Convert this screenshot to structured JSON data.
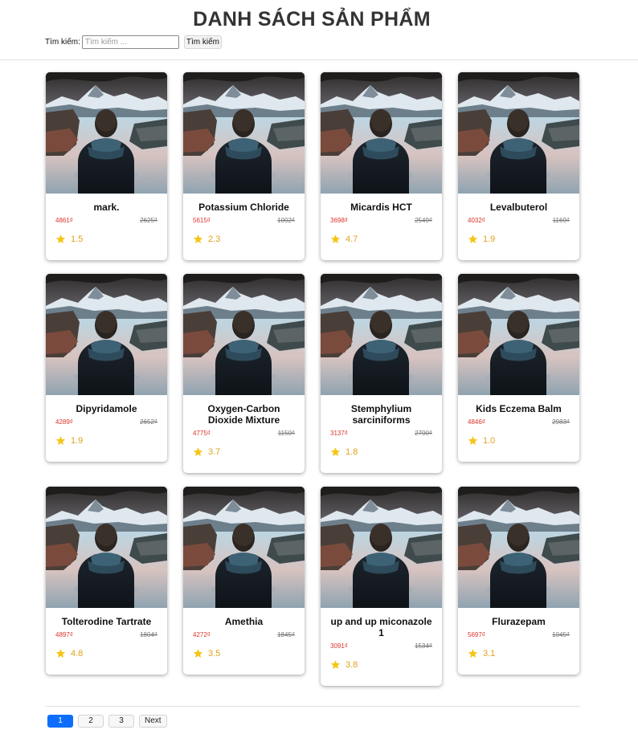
{
  "header": {
    "title": "DANH SÁCH SẢN PHẨM",
    "search_label": "Tìm kiếm:",
    "search_placeholder": "Tìm kiếm ...",
    "search_value": "",
    "search_button": "Tìm kiếm"
  },
  "colors": {
    "price": "#d9342b",
    "star": "#f5c518",
    "rating_text": "#e0a21b",
    "active_page": "#0d6efd"
  },
  "products": [
    {
      "name": "mark.",
      "price": "4861₫",
      "old_price": "2625₫",
      "rating": "1.5"
    },
    {
      "name": "Potassium Chloride",
      "price": "5615₫",
      "old_price": "1002₫",
      "rating": "2.3"
    },
    {
      "name": "Micardis HCT",
      "price": "3698₫",
      "old_price": "2549₫",
      "rating": "4.7"
    },
    {
      "name": "Levalbuterol",
      "price": "4032₫",
      "old_price": "1169₫",
      "rating": "1.9"
    },
    {
      "name": "Dipyridamole",
      "price": "4289₫",
      "old_price": "2652₫",
      "rating": "1.9"
    },
    {
      "name": "Oxygen-Carbon Dioxide Mixture",
      "price": "4775₫",
      "old_price": "1150₫",
      "rating": "3.7"
    },
    {
      "name": "Stemphylium sarciniforms",
      "price": "3137₫",
      "old_price": "2700₫",
      "rating": "1.8"
    },
    {
      "name": "Kids Eczema Balm",
      "price": "4846₫",
      "old_price": "2983₫",
      "rating": "1.0"
    },
    {
      "name": "Tolterodine Tartrate",
      "price": "4897₫",
      "old_price": "1804₫",
      "rating": "4.8"
    },
    {
      "name": "Amethia",
      "price": "4272₫",
      "old_price": "1845₫",
      "rating": "3.5"
    },
    {
      "name": "up and up miconazole 1",
      "price": "3091₫",
      "old_price": "1534₫",
      "rating": "3.8"
    },
    {
      "name": "Flurazepam",
      "price": "5697₫",
      "old_price": "1045₫",
      "rating": "3.1"
    }
  ],
  "pagination": {
    "pages": [
      "1",
      "2",
      "3"
    ],
    "active": "1",
    "next_label": "Next"
  }
}
